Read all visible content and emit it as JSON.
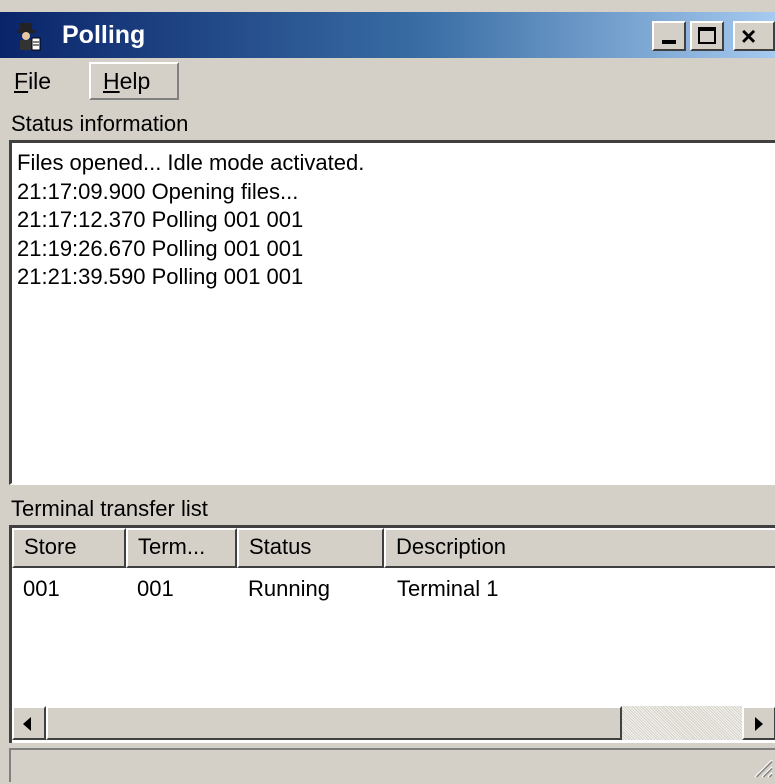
{
  "window": {
    "title": "Polling",
    "icons": {
      "app": "polling-app-icon",
      "minimize": "minimize-icon",
      "maximize": "maximize-icon",
      "close": "close-icon"
    },
    "colors": {
      "titlebar_start": "#0a246a",
      "titlebar_end": "#a6caf0",
      "face": "#d4d0c8"
    }
  },
  "menu": {
    "file": {
      "accel": "F",
      "rest": "ile"
    },
    "help": {
      "accel": "H",
      "rest": "elp"
    }
  },
  "status": {
    "label": "Status information",
    "lines": [
      "Files opened... Idle mode activated.",
      "21:17:09.900 Opening files...",
      "21:17:12.370 Polling 001 001",
      "21:19:26.670 Polling 001 001",
      "21:21:39.590 Polling 001 001"
    ]
  },
  "terminal_list": {
    "label": "Terminal transfer list",
    "columns": [
      "Store",
      "Term...",
      "Status",
      "Description"
    ],
    "rows": [
      {
        "store": "001",
        "terminal": "001",
        "status": "Running",
        "description": "Terminal 1"
      }
    ]
  }
}
